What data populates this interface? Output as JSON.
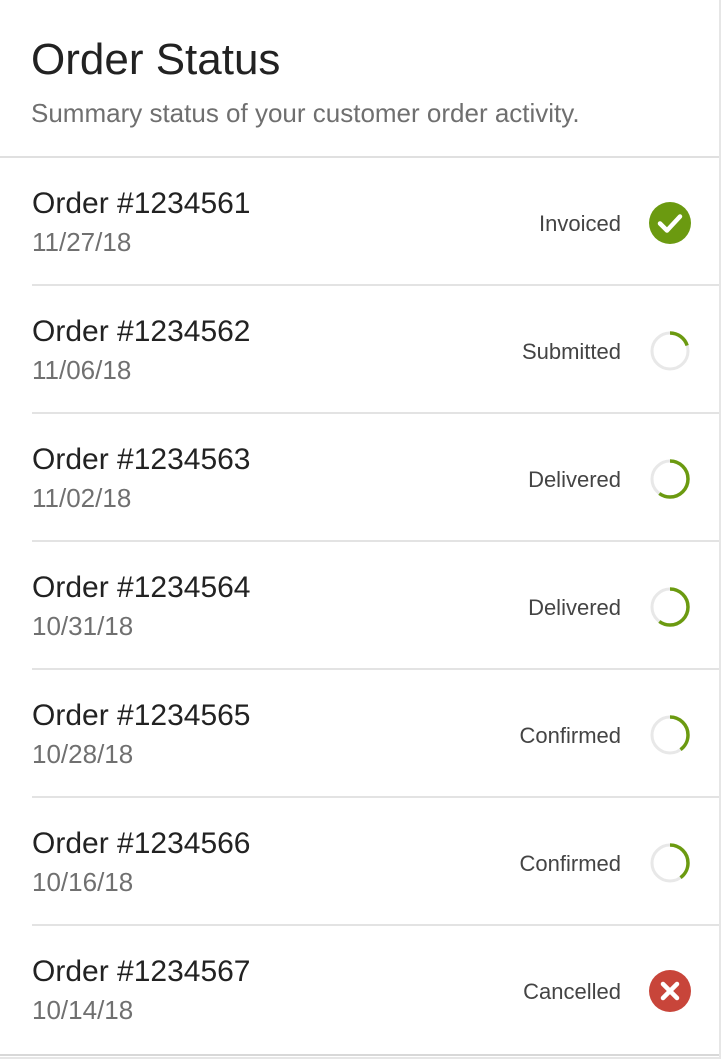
{
  "header": {
    "title": "Order Status",
    "subtitle": "Summary status of your customer order activity."
  },
  "colors": {
    "accent_green": "#6b9a10",
    "track_gray": "#e8e8e8",
    "cancel_red": "#c8453a"
  },
  "orders": [
    {
      "order_id": "Order #1234561",
      "date": "11/27/18",
      "status": "Invoiced",
      "icon": "check-circle-icon",
      "progress": 1.0
    },
    {
      "order_id": "Order #1234562",
      "date": "11/06/18",
      "status": "Submitted",
      "icon": "progress-ring-icon",
      "progress": 0.2
    },
    {
      "order_id": "Order #1234563",
      "date": "11/02/18",
      "status": "Delivered",
      "icon": "progress-ring-icon",
      "progress": 0.6
    },
    {
      "order_id": "Order #1234564",
      "date": "10/31/18",
      "status": "Delivered",
      "icon": "progress-ring-icon",
      "progress": 0.6
    },
    {
      "order_id": "Order #1234565",
      "date": "10/28/18",
      "status": "Confirmed",
      "icon": "progress-ring-icon",
      "progress": 0.4
    },
    {
      "order_id": "Order #1234566",
      "date": "10/16/18",
      "status": "Confirmed",
      "icon": "progress-ring-icon",
      "progress": 0.4
    },
    {
      "order_id": "Order #1234567",
      "date": "10/14/18",
      "status": "Cancelled",
      "icon": "cancel-circle-icon",
      "progress": 0
    }
  ]
}
